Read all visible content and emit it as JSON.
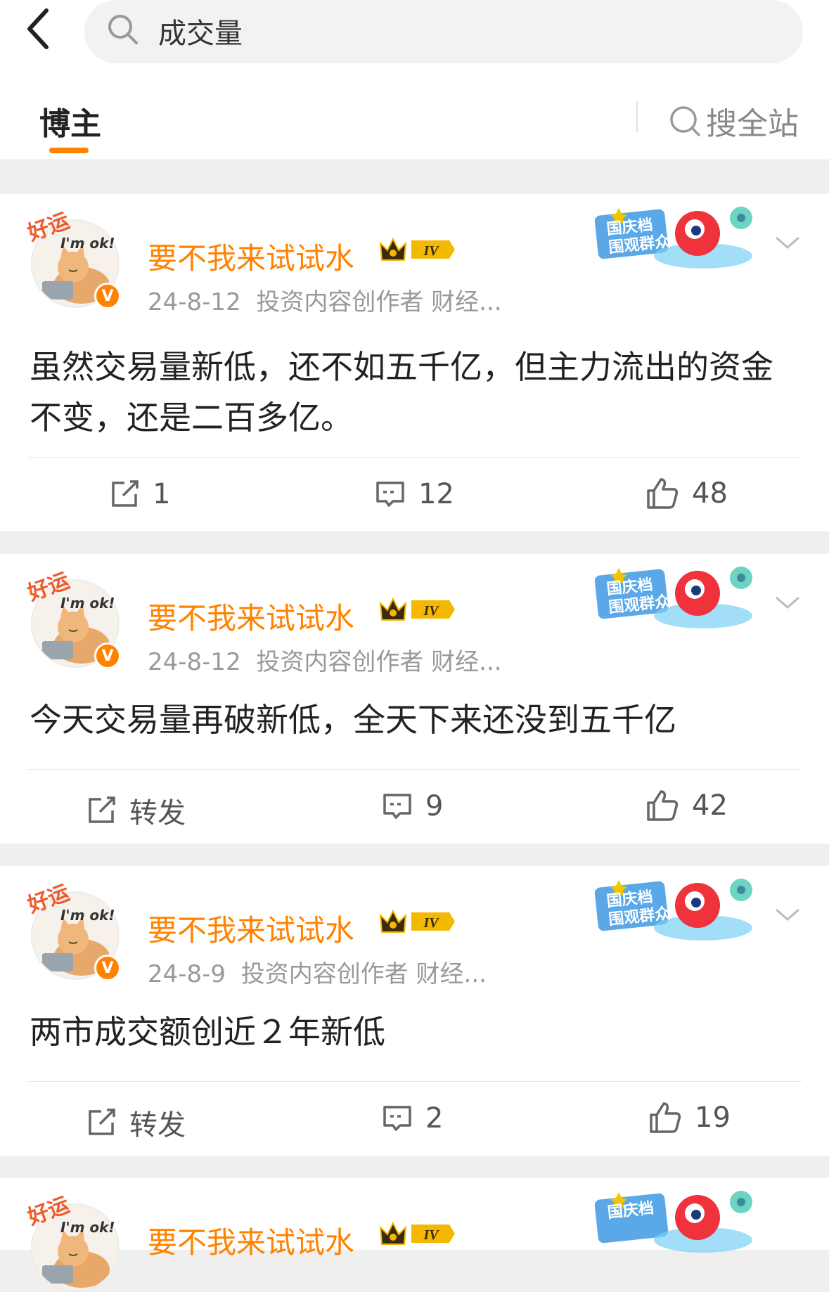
{
  "search": {
    "query": "成交量"
  },
  "tabs": {
    "active": "博主",
    "site_search": "搜全站"
  },
  "colors": {
    "accent": "#ff8200",
    "username": "#ff8200",
    "meta": "#999999"
  },
  "posts": [
    {
      "username": "要不我来试试水",
      "vip_level": "IV",
      "date": "24-8-12",
      "meta": "投资内容创作者  财经...",
      "avatar_text": "好运",
      "avatar_caption": "I'm ok!",
      "verified": "V",
      "promo_line1": "国庆档",
      "promo_line2": "围观群众",
      "text": "虽然交易量新低，还不如五千亿，但主力流出的资金不变，还是二百多亿。",
      "repost": "1",
      "comments": "12",
      "likes": "48"
    },
    {
      "username": "要不我来试试水",
      "vip_level": "IV",
      "date": "24-8-12",
      "meta": "投资内容创作者  财经...",
      "avatar_text": "好运",
      "avatar_caption": "I'm ok!",
      "verified": "V",
      "promo_line1": "国庆档",
      "promo_line2": "围观群众",
      "text": "今天交易量再破新低，全天下来还没到五千亿",
      "repost": "转发",
      "comments": "9",
      "likes": "42"
    },
    {
      "username": "要不我来试试水",
      "vip_level": "IV",
      "date": "24-8-9",
      "meta": "投资内容创作者  财经...",
      "avatar_text": "好运",
      "avatar_caption": "I'm ok!",
      "verified": "V",
      "promo_line1": "国庆档",
      "promo_line2": "围观群众",
      "text": "两市成交额创近２年新低",
      "repost": "转发",
      "comments": "2",
      "likes": "19"
    },
    {
      "username": "要不我来试试水",
      "vip_level": "IV",
      "avatar_text": "好运",
      "avatar_caption": "I'm ok!",
      "promo_line1": "国庆档"
    }
  ]
}
